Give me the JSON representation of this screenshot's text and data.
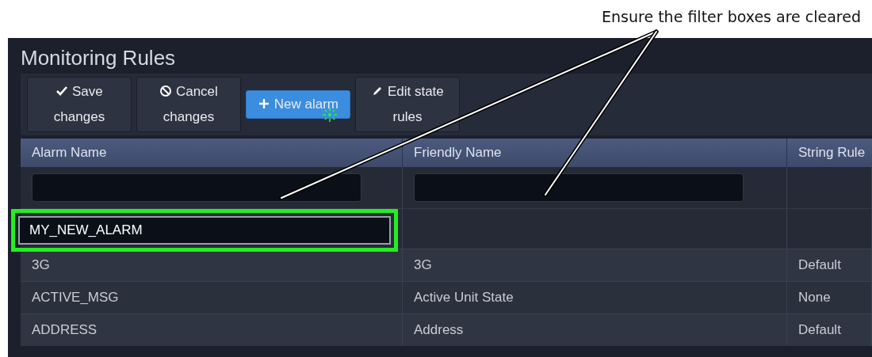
{
  "annotation": {
    "text": "Ensure the filter boxes are cleared"
  },
  "window": {
    "title": "Monitoring Rules"
  },
  "toolbar": [
    {
      "label": "Save changes",
      "kind": "save"
    },
    {
      "label": "Cancel changes",
      "kind": "cancel"
    },
    {
      "label": "New alarm",
      "kind": "new"
    },
    {
      "label": "Edit state rules",
      "kind": "edit"
    }
  ],
  "table": {
    "columns": [
      "Alarm Name",
      "Friendly Name",
      "String Rule"
    ],
    "filter_row": [
      {
        "kind": "field"
      },
      {
        "kind": "field"
      },
      {
        "kind": "none"
      }
    ],
    "new_row": {
      "value": "MY_NEW_ALARM",
      "highlighted": true
    },
    "rows": [
      [
        "3G",
        "3G",
        "Default"
      ],
      [
        "ACTIVE_MSG",
        "Active Unit State",
        "None"
      ],
      [
        "ADDRESS",
        "Address",
        "Default"
      ]
    ]
  }
}
